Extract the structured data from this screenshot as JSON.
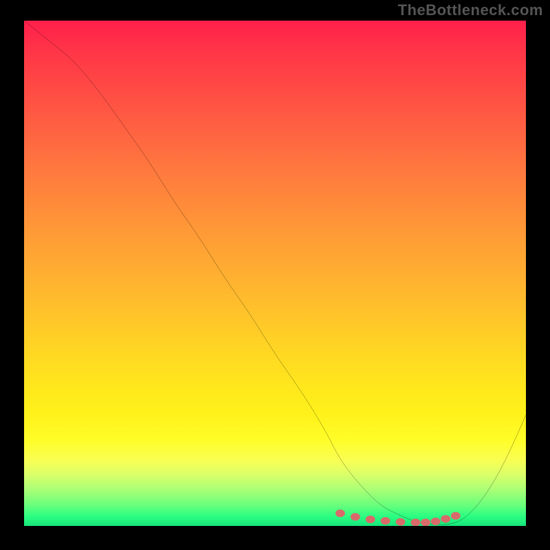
{
  "watermark": "TheBottleneck.com",
  "chart_data": {
    "type": "line",
    "title": "",
    "xlabel": "",
    "ylabel": "",
    "xlim": [
      0,
      100
    ],
    "ylim": [
      0,
      100
    ],
    "x": [
      0,
      5,
      10,
      15,
      20,
      25,
      30,
      35,
      40,
      45,
      50,
      55,
      60,
      63,
      67,
      71,
      75,
      79,
      82,
      85,
      88,
      92,
      96,
      100
    ],
    "values": [
      100,
      96,
      92,
      86,
      79,
      72,
      64,
      57,
      49,
      42,
      34,
      27,
      19,
      13,
      8,
      4,
      2,
      0.5,
      0.2,
      0.3,
      1.5,
      6,
      13,
      22
    ],
    "markers": {
      "x": [
        63,
        66,
        69,
        72,
        75,
        78,
        80,
        82,
        84,
        86
      ],
      "values": [
        2.5,
        1.8,
        1.3,
        1.0,
        0.8,
        0.7,
        0.7,
        0.9,
        1.4,
        2.0
      ]
    },
    "gradient_stops": [
      {
        "pct": 0,
        "color": "#ff1f4b"
      },
      {
        "pct": 50,
        "color": "#ffb92e"
      },
      {
        "pct": 80,
        "color": "#fff21a"
      },
      {
        "pct": 100,
        "color": "#16e57a"
      }
    ]
  }
}
